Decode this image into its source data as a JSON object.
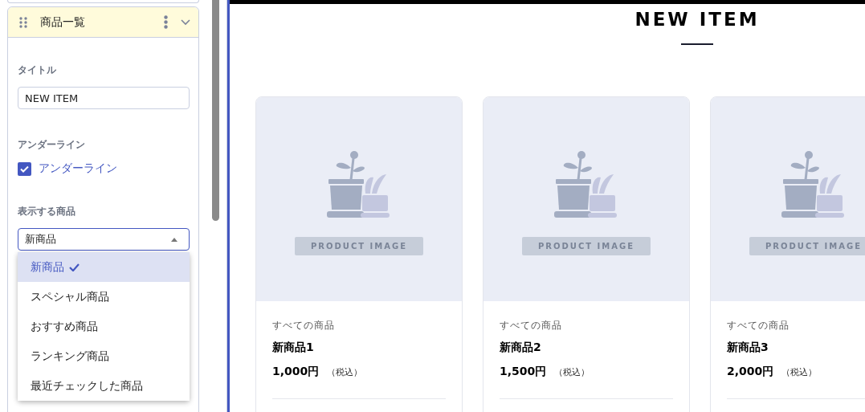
{
  "sidebar": {
    "block_title": "商品一覧",
    "fields": [
      {
        "kind": "text",
        "label": "タイトル",
        "value": "NEW ITEM"
      },
      {
        "kind": "checkbox",
        "label": "アンダーライン",
        "option": "アンダーライン",
        "checked": true
      },
      {
        "kind": "select",
        "label": "表示する商品",
        "value": "新商品",
        "expanded": true,
        "options": [
          {
            "label": "新商品",
            "selected": true
          },
          {
            "label": "スペシャル商品",
            "selected": false
          },
          {
            "label": "おすすめ商品",
            "selected": false
          },
          {
            "label": "ランキング商品",
            "selected": false
          },
          {
            "label": "最近チェックした商品",
            "selected": false
          }
        ]
      }
    ]
  },
  "preview": {
    "heading": "NEW ITEM",
    "underline": true,
    "products": [
      {
        "image_label": "PRODUCT IMAGE",
        "category": "すべての商品",
        "name": "新商品1",
        "price": "1,000円",
        "tax_note": "（税込）"
      },
      {
        "image_label": "PRODUCT IMAGE",
        "category": "すべての商品",
        "name": "新商品2",
        "price": "1,500円",
        "tax_note": "（税込）"
      },
      {
        "image_label": "PRODUCT IMAGE",
        "category": "すべての商品",
        "name": "新商品3",
        "price": "2,000円",
        "tax_note": "（税込）"
      }
    ]
  }
}
